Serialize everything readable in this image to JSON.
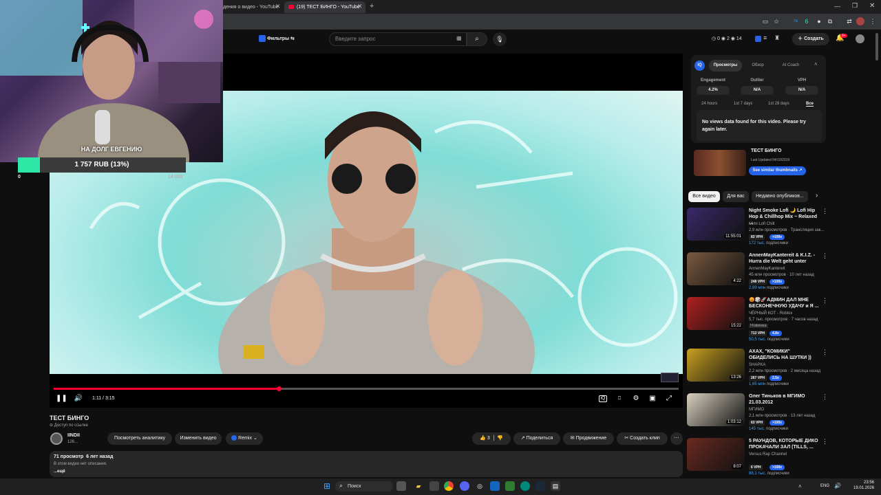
{
  "browser": {
    "tabs": [
      {
        "label": "дения о видео - YouTube",
        "close": "✕"
      },
      {
        "label": "(19) ТЕСТ БИНГО - YouTube",
        "close": "✕"
      }
    ],
    "new_tab": "+"
  },
  "youtube_header": {
    "filters_label": "Фильтры",
    "search_placeholder": "Введите запрос",
    "stats": {
      "a": "0",
      "b": "2",
      "c": "14"
    },
    "create_label": "Создать",
    "notifications_badge": "9+"
  },
  "stream_overlay": {
    "goal_text": "НА ДОЛГ ЕВГЕНИЮ",
    "goal_amount": "1 757 RUB (13%)",
    "goal_progress": 0.13,
    "goal_min": "0",
    "goal_max": "14 000"
  },
  "player": {
    "time": "1:11 / 3:15",
    "progress": 0.36
  },
  "video": {
    "title": "ТЕСТ БИНГО",
    "access": "Доступ по ссылке",
    "channel": "IINDII",
    "subscribers": "126...",
    "analytics_btn": "Посмотреть аналитику",
    "edit_btn": "Изменить видео",
    "remix_btn": "Remix",
    "likes": "3",
    "share_btn": "Поделиться",
    "promote_btn": "Продвижение",
    "clip_btn": "Создать клип",
    "views_date": "71 просмотр  6 лет назад",
    "description": "В этом видео нет описания.",
    "more": "...ещё"
  },
  "vidiq": {
    "tabs": [
      "Просмотры",
      "Обзор",
      "AI Coach"
    ],
    "metrics": [
      {
        "label": "Engagement",
        "value": "4.2%"
      },
      {
        "label": "Outlier",
        "value": "N/A"
      },
      {
        "label": "VPH",
        "value": "N/A"
      }
    ],
    "ranges": [
      "24 hours",
      "1st 7 days",
      "1st 28 days",
      "Все"
    ],
    "message": "No views data found for this video. Please try again later.",
    "video_title": "ТЕСТ БИНГО",
    "last_updated": "Last Updated 04/10/2019",
    "similar_btn": "See similar thumbnails ↗"
  },
  "chips": [
    "Все видео",
    "Для вас",
    "Недавно опубликов..."
  ],
  "recommendations": [
    {
      "title": "Night Smoke Lofi 🌙 Lofi Hip Hop & Chillhop Mix ~ Relaxed ...",
      "channel": "Mimi Lofi Chill",
      "meta": "2,9 млн просмотров · Трансляция зак...",
      "duration": "11:55:01",
      "vph": "83 VPH",
      "badge": ">100x",
      "subs": "172 тыс.",
      "subs_label": "подписчики",
      "color": "#3a2a6a"
    },
    {
      "title": "AnnenMayKantereit & K.I.Z. - Hurra die Welt geht unter",
      "channel": "AnnenMayKantereit",
      "meta": "45 млн просмотров · 10 лет назад",
      "duration": "4:22",
      "vph": "248 VPH",
      "badge": ">100x",
      "subs": "2,89 млн",
      "subs_label": "подписчики",
      "color": "#7a5a40"
    },
    {
      "title": "😡🎲🚀АДМИН ДАЛ МНЕ БЕСКОНЕЧНУЮ УДАЧУ и Я ...",
      "channel": "ЧЁРНЫЙ КОТ - Roblox",
      "meta": "5,7 тыс. просмотров · 7 часов назад",
      "extra": "Новинка",
      "duration": "15:22",
      "vph": "713 VPH",
      "badge": "4.8x",
      "subs": "50,5 тыс.",
      "subs_label": "подписчики",
      "color": "#b02020"
    },
    {
      "title": "АХАХ, \"КОМИКИ\" ОБИДЕЛИСЬ НА ШУТКИ ))",
      "channel": "SHAPKA",
      "meta": "2,2 млн просмотров · 2 месяца назад",
      "duration": "13:26",
      "vph": "267 VPH",
      "badge": "2.5x",
      "subs": "1,65 млн",
      "subs_label": "подписчики",
      "color": "#c8a020"
    },
    {
      "title": "Олег Тиньков в МГИМО 21.03.2012",
      "channel": "МГИМО",
      "meta": "2,1 млн просмотров · 13 лет назад",
      "duration": "1:03:12",
      "vph": "63 VPH",
      "badge": ">100x",
      "subs": "145 тыс.",
      "subs_label": "подписчики",
      "color": "#d8d0c0"
    },
    {
      "title": "5 РАУНДОВ, КОТОРЫЕ ДИКО ПРОКАЧАЛИ ЗАЛ (TILLS, ...",
      "channel": "Versus Rap Channel",
      "meta": "",
      "duration": "8:07",
      "vph": "6 VPH",
      "badge": ">100x",
      "subs": "88,1 тыс.",
      "subs_label": "подписчики",
      "color": "#6a2a20"
    }
  ],
  "taskbar": {
    "search_label": "Поиск",
    "lang": "ENG",
    "time": "23:56",
    "date": "19.01.2026"
  },
  "colors": {
    "accent": "#ff0033",
    "vidiq_blue": "#2563eb",
    "goal_green": "#2ee8a8"
  }
}
